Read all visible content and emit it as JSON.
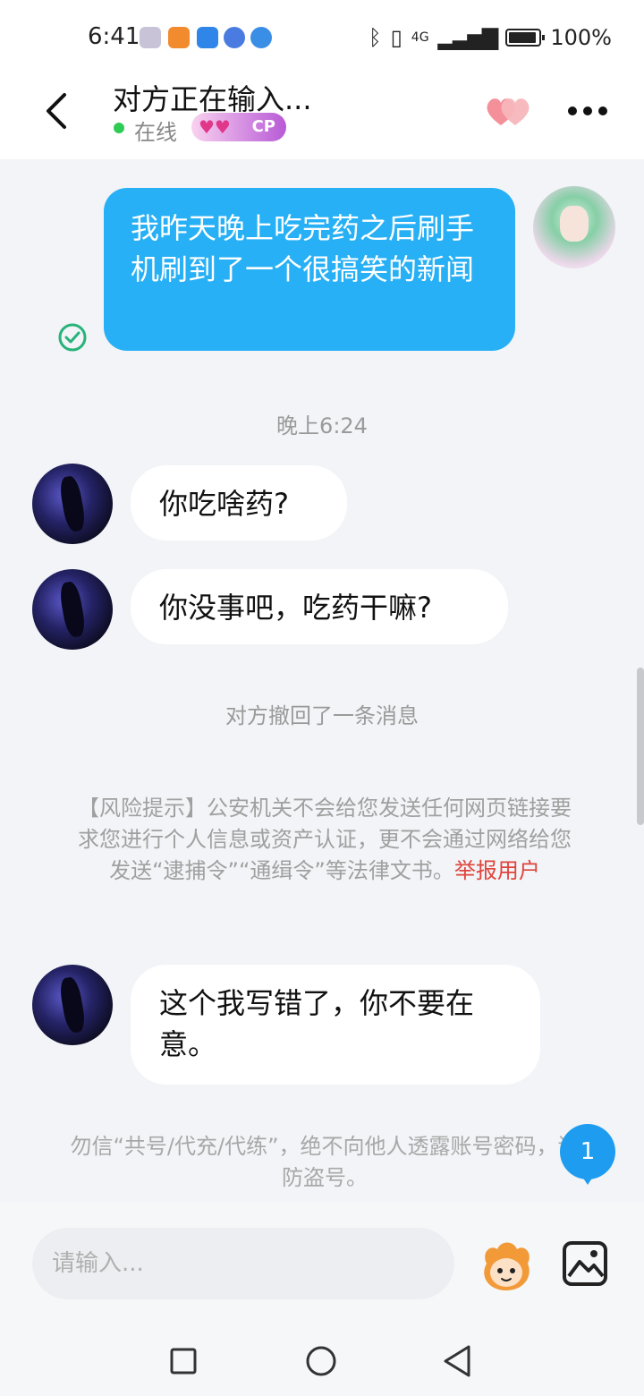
{
  "status_bar": {
    "time": "6:41",
    "network": "4G",
    "battery": "100%"
  },
  "header": {
    "title": "对方正在输入...",
    "status": "在线",
    "badge": "CP"
  },
  "messages": {
    "outgoing_1": "我昨天晚上吃完药之后刷手机刷到了一个很搞笑的新闻",
    "time_label": "晚上6:24",
    "incoming_1": "你吃啥药?",
    "incoming_2": "你没事吧，吃药干嘛?",
    "recall_notice": "对方撤回了一条消息",
    "risk_notice": "【风险提示】公安机关不会给您发送任何网页链接要求您进行个人信息或资产认证，更不会通过网络给您发送“逮捕令”“通缉令”等法律文书。",
    "report_link": "举报用户",
    "incoming_3": "这个我写错了，你不要在意。",
    "security_warning": "勿信“共号/代充/代练”，绝不向他人透露账号密码，谨防盗号。"
  },
  "unread_count": "1",
  "input": {
    "placeholder": "请输入..."
  },
  "colors": {
    "outgoing_bubble": "#27b0f5",
    "online": "#2ecc55",
    "report": "#e0433b",
    "badge": "#1e9cf0"
  },
  "icons": [
    "back-icon",
    "heart-icon",
    "more-icon",
    "read-check-icon",
    "sticker-icon",
    "image-icon",
    "nav-square-icon",
    "nav-circle-icon",
    "nav-back-icon"
  ]
}
